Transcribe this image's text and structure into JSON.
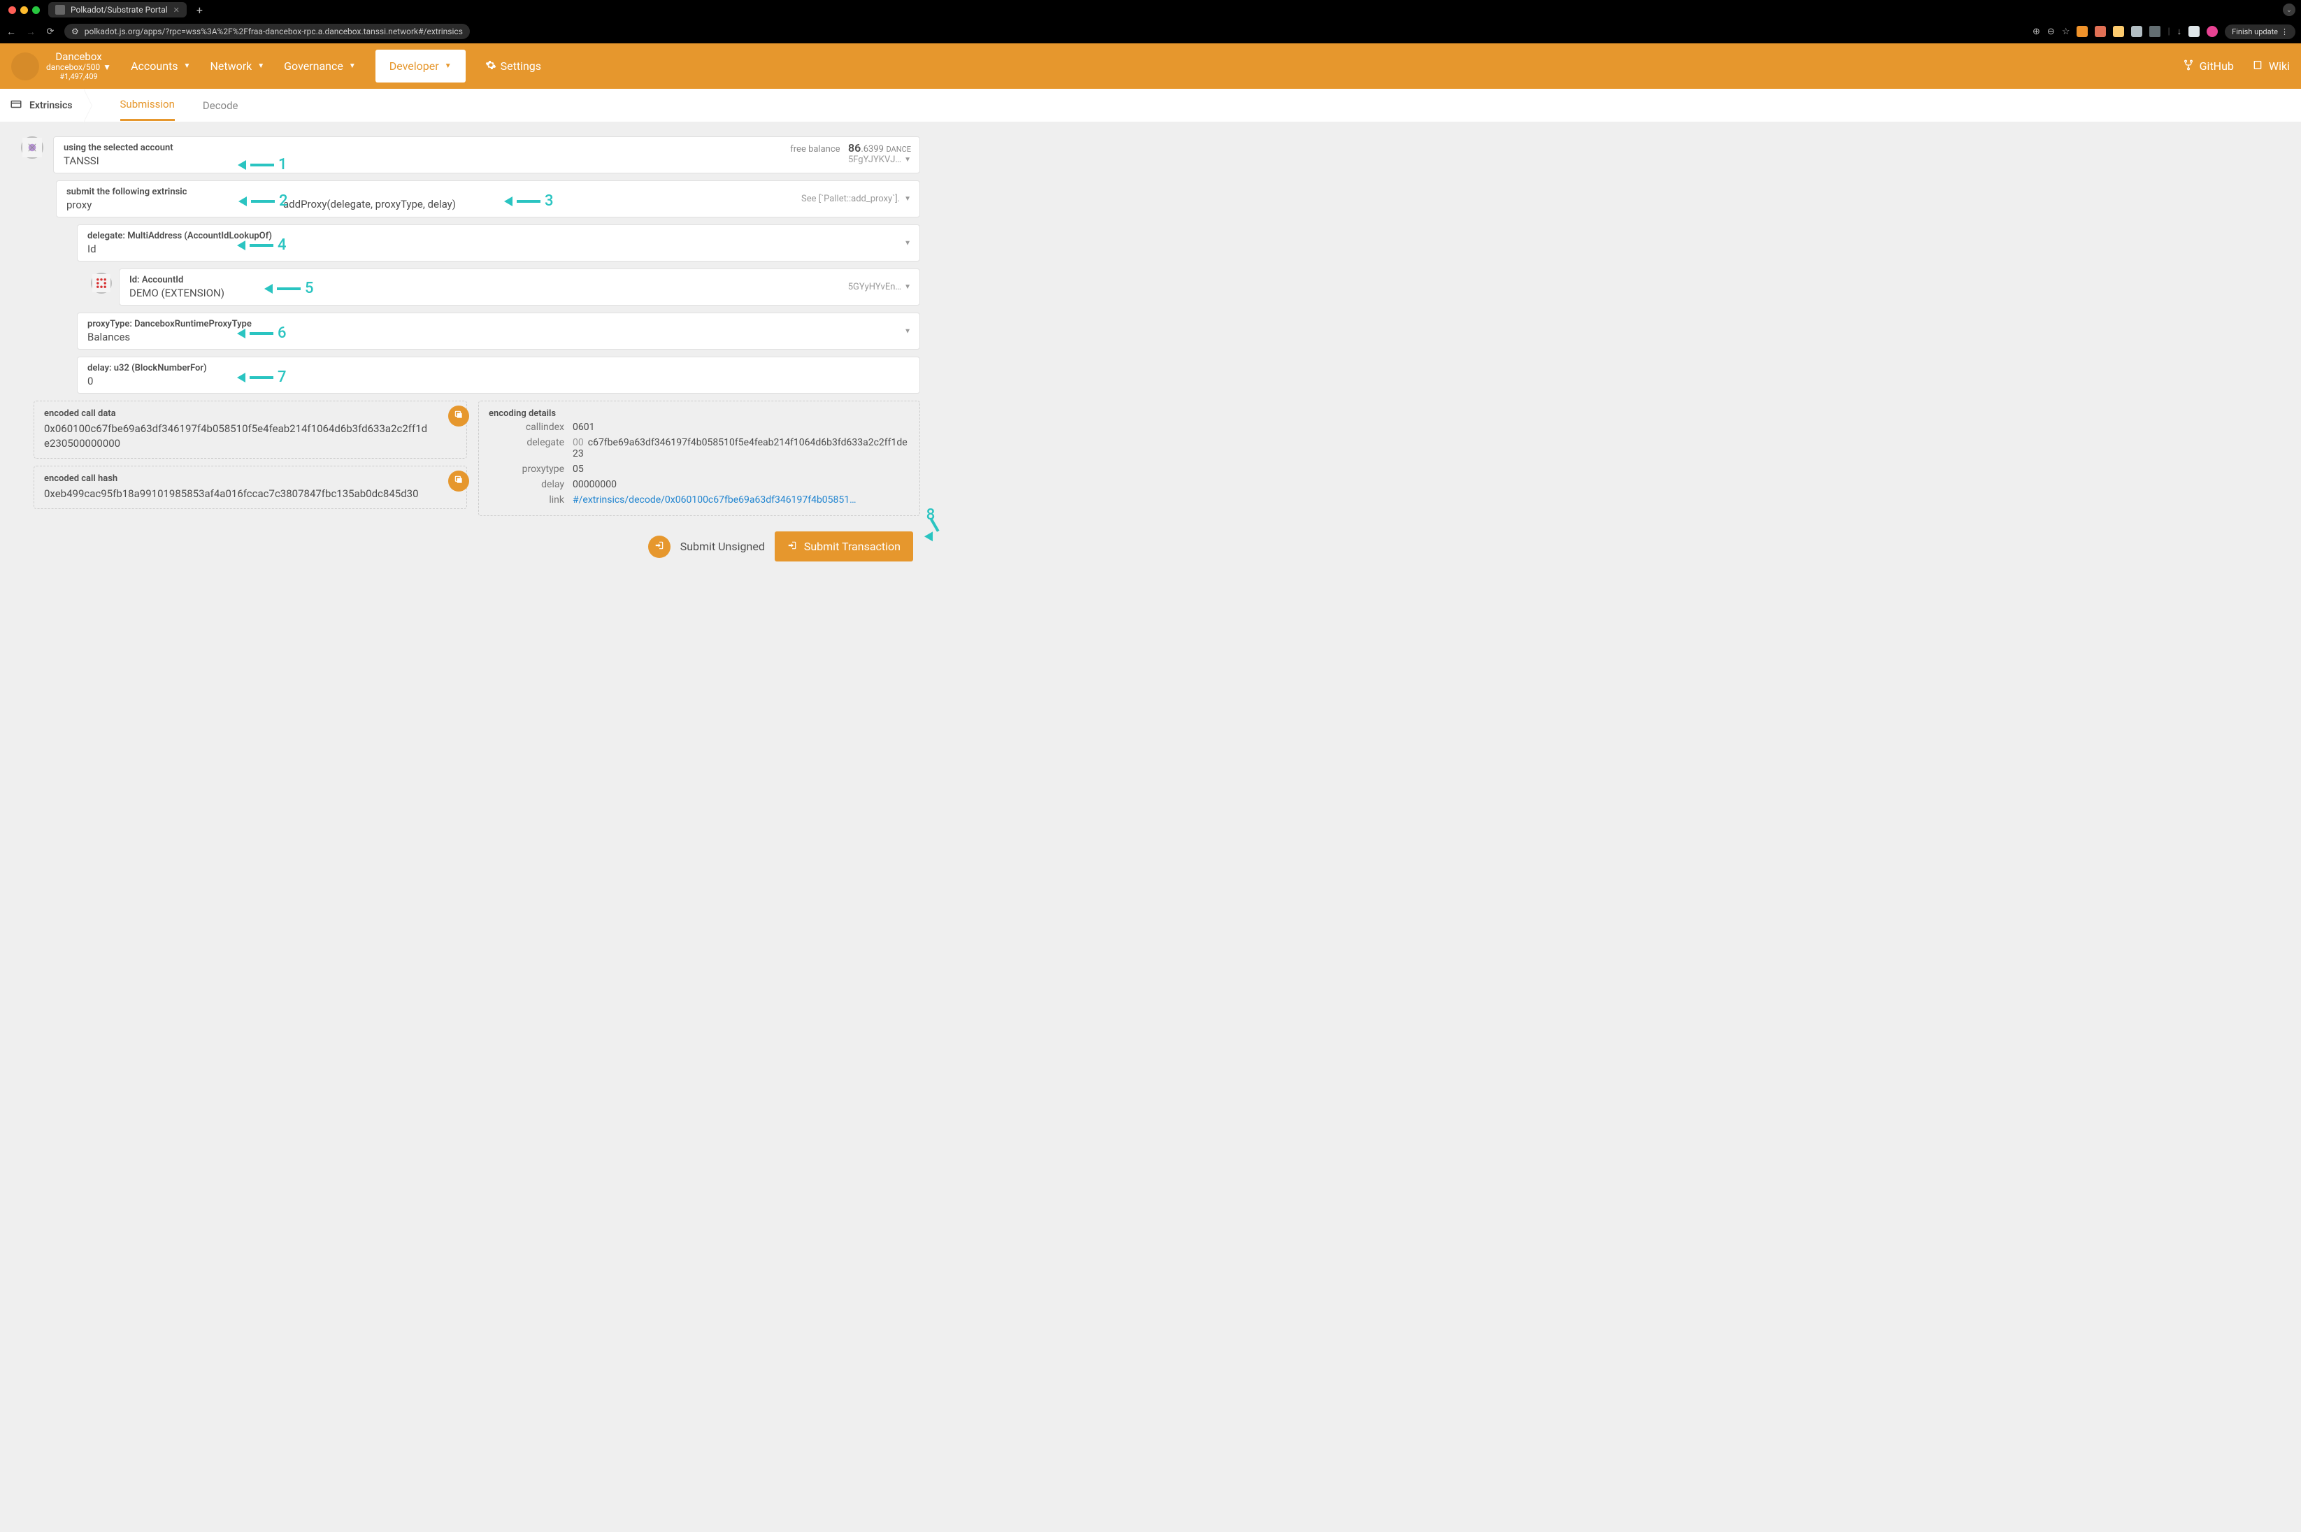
{
  "browser": {
    "tab_title": "Polkadot/Substrate Portal",
    "url": "polkadot.js.org/apps/?rpc=wss%3A%2F%2Ffraa-dancebox-rpc.a.dancebox.tanssi.network#/extrinsics",
    "finish_update": "Finish update"
  },
  "header": {
    "chain_name": "Dancebox",
    "chain_sub": "dancebox/500",
    "block": "#1,497,409",
    "nav": {
      "accounts": "Accounts",
      "network": "Network",
      "governance": "Governance",
      "developer": "Developer",
      "settings": "Settings"
    },
    "github": "GitHub",
    "wiki": "Wiki"
  },
  "tabs": {
    "page": "Extrinsics",
    "submission": "Submission",
    "decode": "Decode"
  },
  "account": {
    "label": "using the selected account",
    "value": "TANSSI",
    "balance_label": "free balance",
    "balance_int": "86",
    "balance_frac": ".6399",
    "balance_unit": "DANCE",
    "addr_short": "5FgYJYKVJ…"
  },
  "extrinsic": {
    "label": "submit the following extrinsic",
    "pallet": "proxy",
    "call": "addProxy(delegate, proxyType, delay)",
    "hint": "See [`Pallet::add_proxy`]."
  },
  "params": {
    "delegate": {
      "label": "delegate: MultiAddress (AccountIdLookupOf)",
      "value": "Id"
    },
    "accountid": {
      "label": "Id: AccountId",
      "value": "DEMO (EXTENSION)",
      "addr": "5GYyHYvEn…"
    },
    "proxytype": {
      "label": "proxyType: DanceboxRuntimeProxyType",
      "value": "Balances"
    },
    "delay": {
      "label": "delay: u32 (BlockNumberFor)",
      "value": "0"
    }
  },
  "encoded": {
    "call_data_label": "encoded call data",
    "call_data": "0x060100c67fbe69a63df346197f4b058510f5e4feab214f1064d6b3fd633a2c2ff1de230500000000",
    "call_hash_label": "encoded call hash",
    "call_hash": "0xeb499cac95fb18a99101985853af4a016fccac7c3807847fbc135ab0dc845d30"
  },
  "details": {
    "label": "encoding details",
    "callindex_k": "callindex",
    "callindex_v": "0601",
    "delegate_k": "delegate",
    "delegate_pre": "00",
    "delegate_v": "c67fbe69a63df346197f4b058510f5e4feab214f1064d6b3fd633a2c2ff1de23",
    "proxytype_k": "proxytype",
    "proxytype_v": "05",
    "delay_k": "delay",
    "delay_v": "00000000",
    "link_k": "link",
    "link_v": "#/extrinsics/decode/0x060100c67fbe69a63df346197f4b05851…"
  },
  "buttons": {
    "unsigned": "Submit Unsigned",
    "submit": "Submit Transaction"
  },
  "annotations": {
    "n1": "1",
    "n2": "2",
    "n3": "3",
    "n4": "4",
    "n5": "5",
    "n6": "6",
    "n7": "7",
    "n8": "8"
  }
}
